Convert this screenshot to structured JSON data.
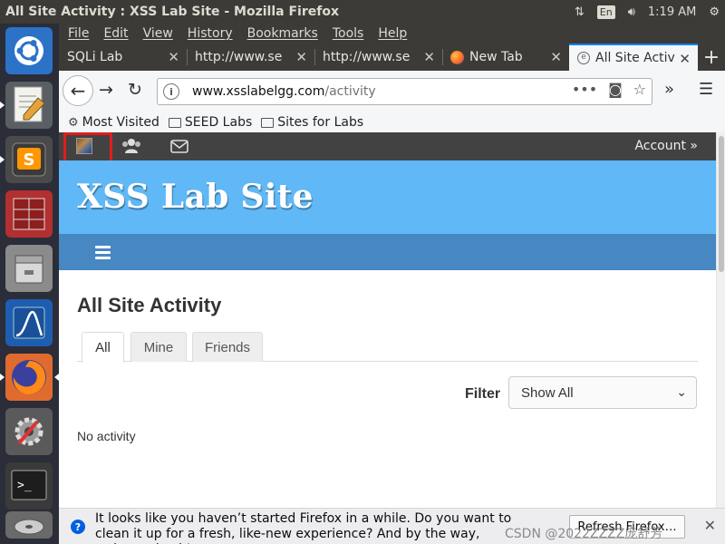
{
  "window": {
    "title": "All Site Activity : XSS Lab Site - Mozilla Firefox",
    "keyboard_layout": "En",
    "time": "1:19 AM"
  },
  "launcher": {
    "items": [
      {
        "name": "ubuntu-dash-icon"
      },
      {
        "name": "text-editor-icon"
      },
      {
        "name": "sublime-text-icon"
      },
      {
        "name": "ghex-icon"
      },
      {
        "name": "files-icon"
      },
      {
        "name": "wireshark-icon"
      },
      {
        "name": "firefox-icon"
      },
      {
        "name": "system-settings-icon"
      },
      {
        "name": "terminal-icon"
      },
      {
        "name": "disk-icon"
      }
    ]
  },
  "menubar": {
    "items": [
      "File",
      "Edit",
      "View",
      "History",
      "Bookmarks",
      "Tools",
      "Help"
    ]
  },
  "tabs": [
    {
      "label": "SQLi Lab",
      "active": false
    },
    {
      "label": "http://www.se",
      "active": false
    },
    {
      "label": "http://www.se",
      "active": false
    },
    {
      "label": "New Tab",
      "active": false
    },
    {
      "label": "All Site Activ",
      "active": true
    }
  ],
  "navbar": {
    "url_domain": "www.xsslabelgg.com",
    "url_path": "/activity"
  },
  "bookmarks": {
    "items": [
      "Most Visited",
      "SEED Labs",
      "Sites for Labs"
    ]
  },
  "site": {
    "account_label": "Account »",
    "site_title": "XSS Lab Site",
    "page_title": "All Site Activity",
    "tabs": [
      "All",
      "Mine",
      "Friends"
    ],
    "filter_label": "Filter",
    "filter_value": "Show All",
    "no_activity": "No activity",
    "colors": {
      "header_bg": "#60b8f7",
      "subnav_bg": "#4787c2",
      "topbar_bg": "#424242",
      "highlight_box": "#e01d1d"
    }
  },
  "notification": {
    "message": "It looks like you haven’t started Firefox in a while. Do you want to clean it up for a fresh, like-new experience? And by the way, welcome back!",
    "button": "Refresh Firefox…",
    "watermark": "CSDN @2022ZZZZ庞舒芳"
  }
}
